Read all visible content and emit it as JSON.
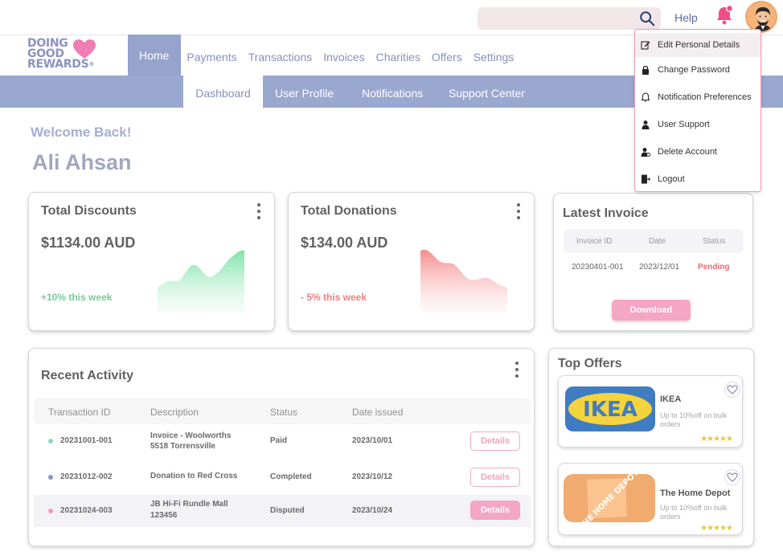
{
  "header": {
    "search_placeholder": "",
    "help_label": "Help",
    "icons": [
      "search-icon",
      "bell-icon",
      "avatar"
    ]
  },
  "brand": {
    "line1": "DOING",
    "line2": "GOOD",
    "line3": "REWARDS",
    "mark": "®"
  },
  "main_nav": [
    "Home",
    "Payments",
    "Transactions",
    "Invoices",
    "Charities",
    "Offers",
    "Settings"
  ],
  "sub_nav": [
    "Dashboard",
    "User Profile",
    "Notifications",
    "Support Center"
  ],
  "welcome": {
    "greeting": "Welcome Back!",
    "name": "Ali Ahsan"
  },
  "total_discounts": {
    "title": "Total Discounts",
    "amount": "$1134.00 AUD",
    "trend": "+10% this week"
  },
  "total_donations": {
    "title": "Total Donations",
    "amount": "$134.00 AUD",
    "trend": "- 5% this week"
  },
  "latest_invoice": {
    "title": "Latest Invoice",
    "columns": [
      "Invoice ID",
      "Date",
      "Status"
    ],
    "row": [
      "20230401-001",
      "2023/12/01",
      "Pending"
    ],
    "download_label": "Download"
  },
  "recent_activity": {
    "title": "Recent Activity",
    "columns": [
      "Transaction ID",
      "Description",
      "Status",
      "Date issued"
    ],
    "rows": [
      {
        "id": "20231001-001",
        "desc1": "Invoice - Woolworths",
        "desc2": "5518 Torrensville",
        "status": "Paid",
        "date": "2023/10/01",
        "action": "Details"
      },
      {
        "id": "20231012-002",
        "desc1": "Donation to Red Cross",
        "desc2": "",
        "status": "Completed",
        "date": "2023/10/12",
        "action": "Details"
      },
      {
        "id": "20231024-003",
        "desc1": "JB Hi-Fi Rundle Mall",
        "desc2": "123456",
        "status": "Disputed",
        "date": "2023/10/24",
        "action": "Details"
      }
    ]
  },
  "top_offers": {
    "title": "Top Offers",
    "items": [
      {
        "name": "IKEA",
        "desc": "Up to 10%off on bulk orders",
        "logo_text": "IKEA",
        "stars": "★★★★★"
      },
      {
        "name": "The Home Depot",
        "desc": "Up to 10%off on bulk orders",
        "logo_text": "THE HOME DEPOT",
        "stars": "★★★★★"
      }
    ]
  },
  "profile_menu": [
    {
      "label": "Edit  Personal Details",
      "icon": "edit-icon"
    },
    {
      "label": "Change Password",
      "icon": "lock-icon"
    },
    {
      "label": "Notification Preferences",
      "icon": "bell-settings-icon"
    },
    {
      "label": "User Support",
      "icon": "support-agent-icon"
    },
    {
      "label": "Delete Account",
      "icon": "user-remove-icon"
    },
    {
      "label": "Logout",
      "icon": "logout-icon"
    }
  ],
  "colors": {
    "nav_active": "#96a3cd",
    "subnav": "#9aa7cf",
    "accent_pink": "#f4a6c4",
    "positive": "#7bc89a",
    "negative": "#ef7f7f",
    "pending": "#e66a73",
    "dot_colors": [
      "#8fd6b0",
      "#8c94c4",
      "#f39ab8"
    ]
  }
}
